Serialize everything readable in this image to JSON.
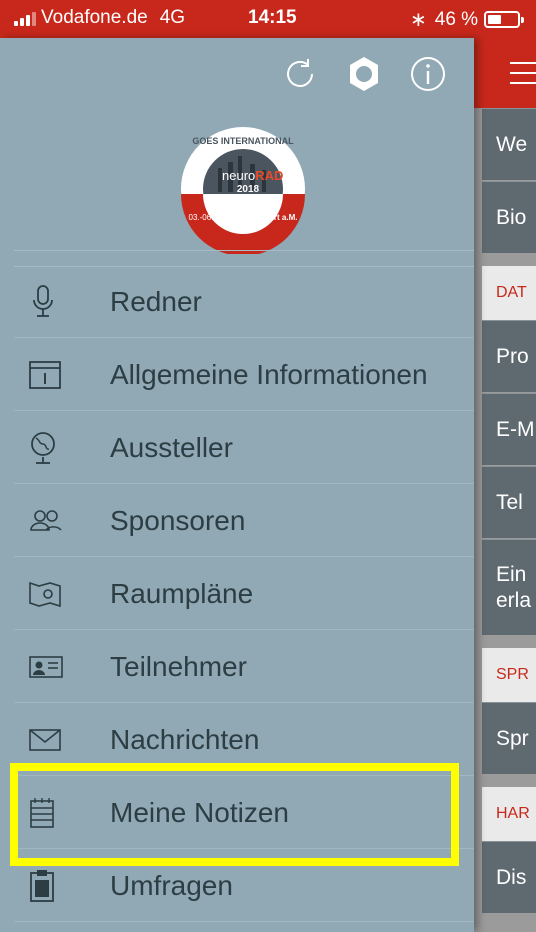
{
  "status_bar": {
    "carrier": "Vodafone.de",
    "network": "4G",
    "time": "14:15",
    "battery": "46 %",
    "battery_level": 0.46
  },
  "drawer": {
    "menu_items": [
      {
        "label": "Redner",
        "icon": "microphone-icon"
      },
      {
        "label": "Allgemeine Informationen",
        "icon": "info-box-icon"
      },
      {
        "label": "Aussteller",
        "icon": "globe-icon"
      },
      {
        "label": "Sponsoren",
        "icon": "people-icon"
      },
      {
        "label": "Raumpläne",
        "icon": "map-pin-icon"
      },
      {
        "label": "Teilnehmer",
        "icon": "id-card-icon"
      },
      {
        "label": "Nachrichten",
        "icon": "envelope-icon"
      },
      {
        "label": "Meine Notizen",
        "icon": "notepad-icon"
      },
      {
        "label": "Umfragen",
        "icon": "clipboard-icon"
      }
    ],
    "top_icons": [
      "refresh-icon",
      "gear-icon",
      "info-icon"
    ],
    "logo": {
      "arc_text": "GOES INTERNATIONAL",
      "name_part1": "neuro",
      "name_part2": "RAD",
      "year": "2018",
      "dates": "03.-06.10.2018",
      "city": "Frankfurt a.M."
    }
  },
  "main": {
    "rows": [
      {
        "kind": "row",
        "label": "We"
      },
      {
        "kind": "row",
        "label": "Bio"
      },
      {
        "kind": "section",
        "label": "DAT"
      },
      {
        "kind": "row",
        "label": "Pro"
      },
      {
        "kind": "row",
        "label": "E-M"
      },
      {
        "kind": "row",
        "label": "Tel"
      },
      {
        "kind": "row",
        "label": "Ein\nerla"
      },
      {
        "kind": "section",
        "label": "SPR"
      },
      {
        "kind": "row",
        "label": "Spr"
      },
      {
        "kind": "section",
        "label": "HAR"
      },
      {
        "kind": "row",
        "label": "Dis"
      }
    ]
  },
  "colors": {
    "brand_red": "#c8281b",
    "drawer_bg": "#90a9b4",
    "highlight": "#ffff00"
  }
}
